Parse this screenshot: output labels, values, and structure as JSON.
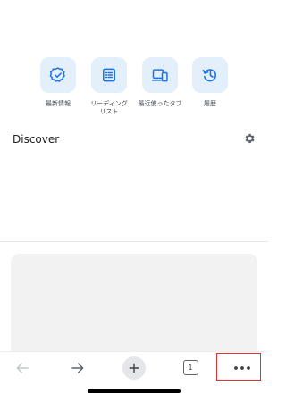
{
  "shortcuts": [
    {
      "label": "最新情報",
      "icon": "check-badge-icon"
    },
    {
      "label": "リーディング\nリスト",
      "icon": "reading-list-icon"
    },
    {
      "label": "最近使ったタブ",
      "icon": "devices-icon"
    },
    {
      "label": "履歴",
      "icon": "history-icon"
    }
  ],
  "discover": {
    "title": "Discover",
    "settings_icon": "gear-icon"
  },
  "toolbar": {
    "back_icon": "back-arrow-icon",
    "forward_icon": "forward-arrow-icon",
    "new_tab_icon": "plus-icon",
    "tab_count": "1",
    "menu_icon": "more-dots-icon"
  },
  "colors": {
    "accent": "#1a73e8",
    "tile_bg": "#e4effc",
    "highlight": "#e0312f"
  }
}
